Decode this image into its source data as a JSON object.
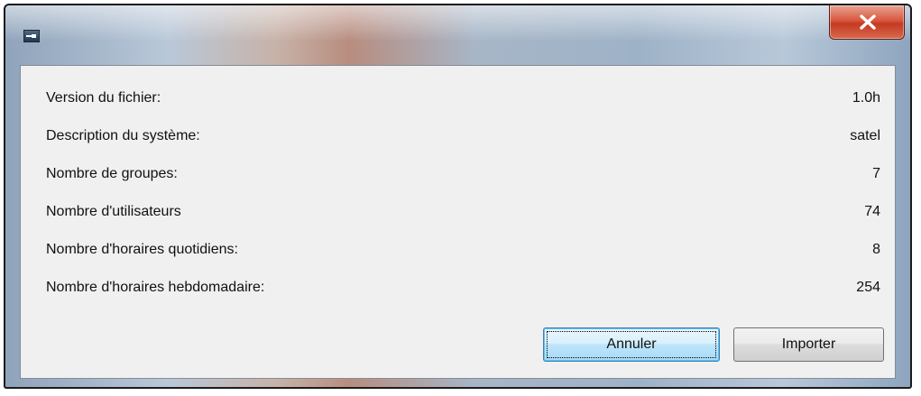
{
  "window": {
    "title": "",
    "close_label": "X"
  },
  "info": {
    "rows": [
      {
        "label": "Version du fichier:",
        "value": "1.0h"
      },
      {
        "label": "Description du système:",
        "value": "satel"
      },
      {
        "label": "Nombre de groupes:",
        "value": "7"
      },
      {
        "label": "Nombre d'utilisateurs",
        "value": "74"
      },
      {
        "label": "Nombre d'horaires quotidiens:",
        "value": "8"
      },
      {
        "label": "Nombre d'horaires hebdomadaire:",
        "value": "254"
      }
    ]
  },
  "buttons": {
    "cancel_label": "Annuler",
    "import_label": "Importer"
  },
  "colors": {
    "focus_button": "#bee6fd",
    "close_button": "#c43a22",
    "client_background": "#f0f0f0"
  },
  "icons": {
    "app": "app-icon",
    "close": "close-icon"
  }
}
